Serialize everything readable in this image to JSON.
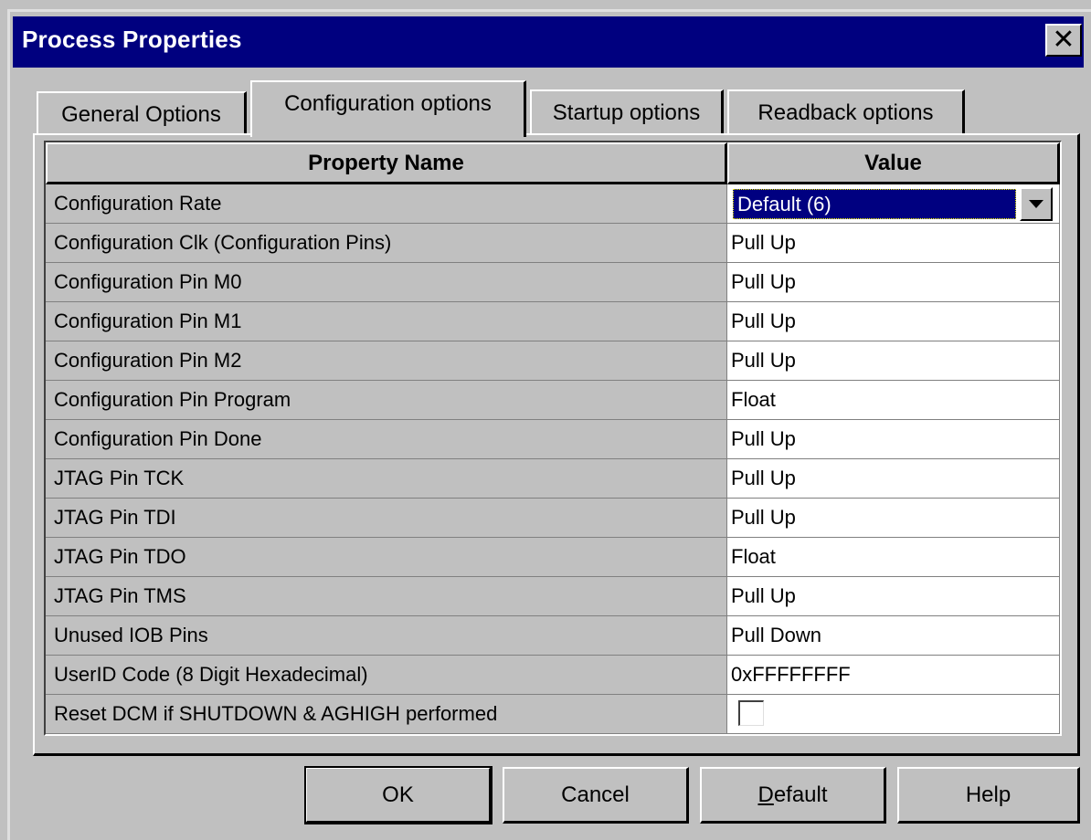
{
  "window": {
    "title": "Process Properties",
    "close_glyph": "✕"
  },
  "tabs": [
    {
      "label": "General Options",
      "active": false
    },
    {
      "label": "Configuration options",
      "active": true
    },
    {
      "label": "Startup options",
      "active": false
    },
    {
      "label": "Readback options",
      "active": false
    }
  ],
  "grid": {
    "columns": [
      "Property Name",
      "Value"
    ],
    "rows": [
      {
        "name": "Configuration Rate",
        "value": "Default (6)"
      },
      {
        "name": "Configuration Clk (Configuration Pins)",
        "value": "Pull Up"
      },
      {
        "name": "Configuration Pin M0",
        "value": "Pull Up"
      },
      {
        "name": "Configuration Pin M1",
        "value": "Pull Up"
      },
      {
        "name": "Configuration Pin M2",
        "value": "Pull Up"
      },
      {
        "name": "Configuration Pin Program",
        "value": "Float"
      },
      {
        "name": "Configuration Pin Done",
        "value": "Pull Up"
      },
      {
        "name": "JTAG Pin TCK",
        "value": "Pull Up"
      },
      {
        "name": "JTAG Pin TDI",
        "value": "Pull Up"
      },
      {
        "name": "JTAG Pin TDO",
        "value": "Float"
      },
      {
        "name": "JTAG Pin TMS",
        "value": "Pull Up"
      },
      {
        "name": "Unused IOB Pins",
        "value": "Pull Down"
      },
      {
        "name": "UserID Code (8 Digit Hexadecimal)",
        "value": "0xFFFFFFFF"
      },
      {
        "name": "Reset DCM if SHUTDOWN & AGHIGH performed",
        "value": "",
        "checked": false
      }
    ]
  },
  "buttons": {
    "ok": "OK",
    "cancel": "Cancel",
    "default_accel": "D",
    "default_rest": "efault",
    "help": "Help"
  },
  "colors": {
    "titlebar": "#00007f",
    "face": "#c0c0c0",
    "selection": "#000080"
  }
}
